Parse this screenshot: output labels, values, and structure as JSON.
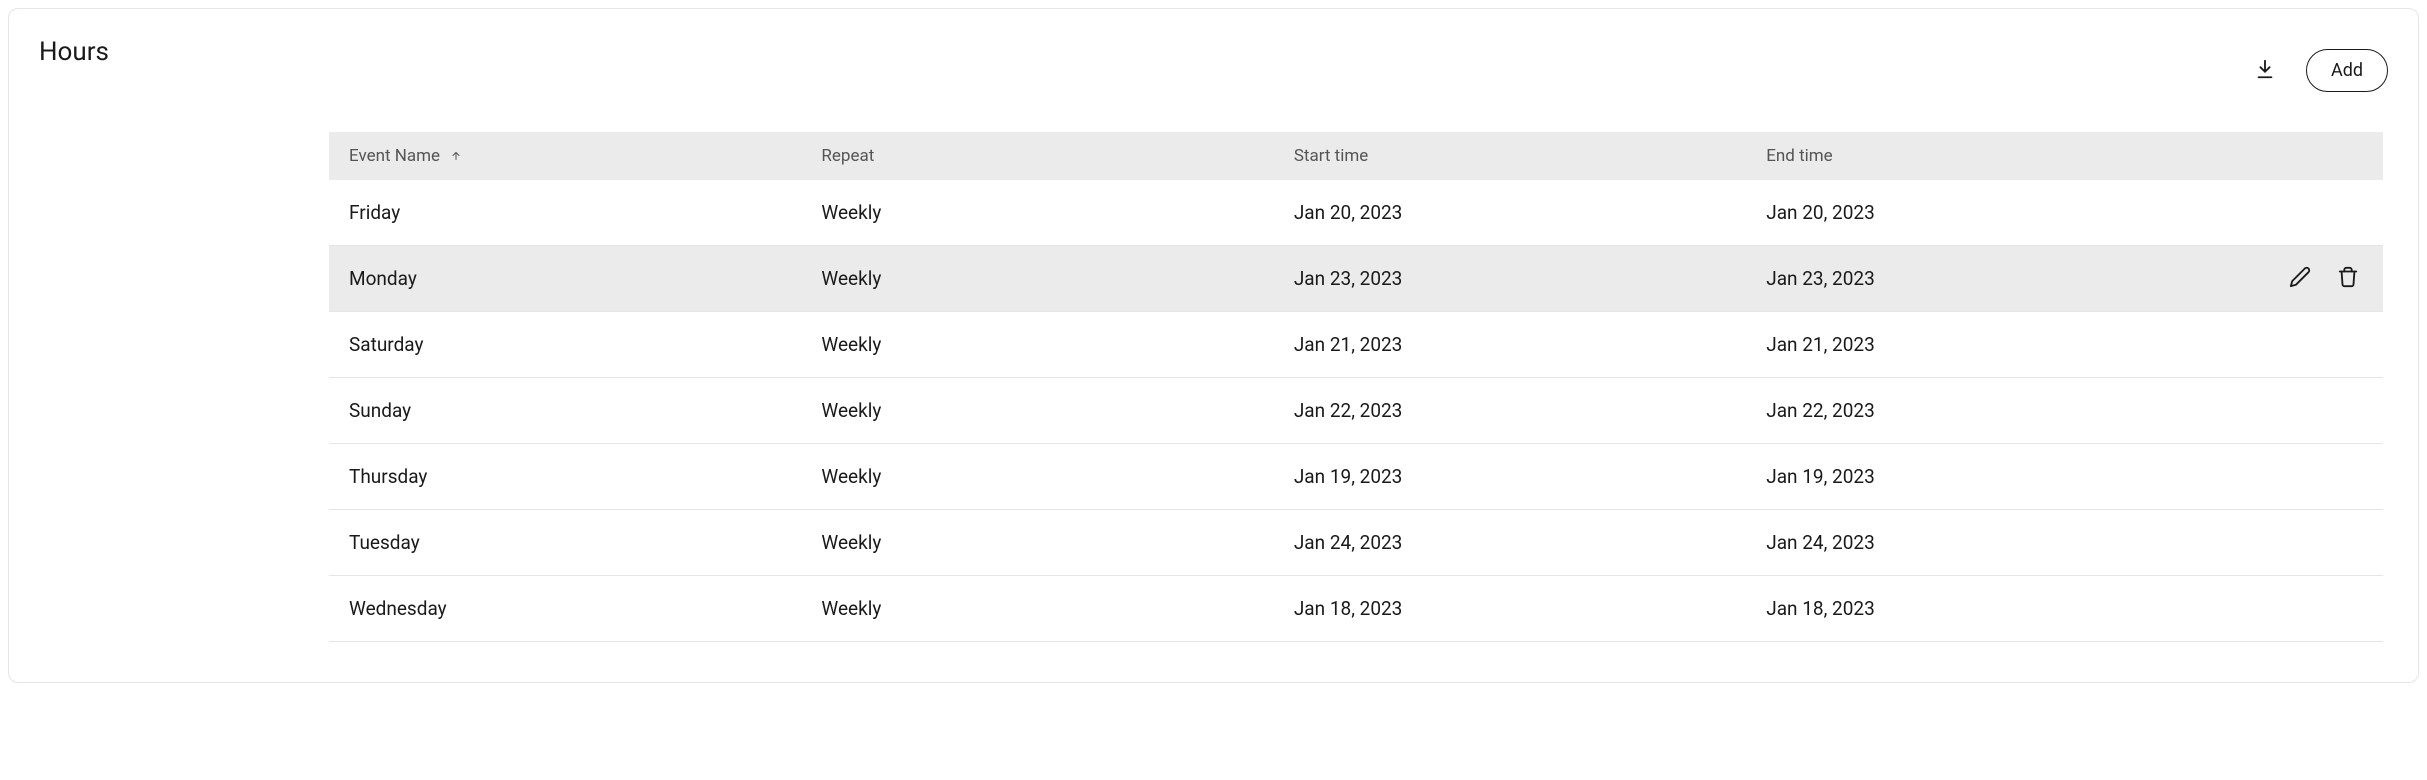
{
  "header": {
    "title": "Hours",
    "add_label": "Add"
  },
  "table": {
    "columns": {
      "event_name": "Event Name",
      "repeat": "Repeat",
      "start_time": "Start time",
      "end_time": "End time"
    },
    "rows": [
      {
        "event_name": "Friday",
        "repeat": "Weekly",
        "start_time": "Jan 20, 2023",
        "end_time": "Jan 20, 2023",
        "hovered": false
      },
      {
        "event_name": "Monday",
        "repeat": "Weekly",
        "start_time": "Jan 23, 2023",
        "end_time": "Jan 23, 2023",
        "hovered": true
      },
      {
        "event_name": "Saturday",
        "repeat": "Weekly",
        "start_time": "Jan 21, 2023",
        "end_time": "Jan 21, 2023",
        "hovered": false
      },
      {
        "event_name": "Sunday",
        "repeat": "Weekly",
        "start_time": "Jan 22, 2023",
        "end_time": "Jan 22, 2023",
        "hovered": false
      },
      {
        "event_name": "Thursday",
        "repeat": "Weekly",
        "start_time": "Jan 19, 2023",
        "end_time": "Jan 19, 2023",
        "hovered": false
      },
      {
        "event_name": "Tuesday",
        "repeat": "Weekly",
        "start_time": "Jan 24, 2023",
        "end_time": "Jan 24, 2023",
        "hovered": false
      },
      {
        "event_name": "Wednesday",
        "repeat": "Weekly",
        "start_time": "Jan 18, 2023",
        "end_time": "Jan 18, 2023",
        "hovered": false
      }
    ]
  }
}
